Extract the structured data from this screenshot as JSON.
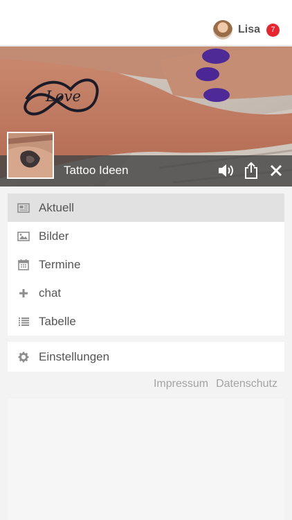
{
  "user": {
    "name": "Lisa",
    "notification_count": "7",
    "avatar_icon": "user-avatar"
  },
  "hero": {
    "title": "Tattoo Ideen",
    "tattoo_text": "Love",
    "bar_color": "#474747",
    "icons": [
      "volume-icon",
      "share-icon",
      "close-icon"
    ]
  },
  "menu": {
    "items": [
      {
        "label": "Aktuell",
        "icon": "newspaper-icon",
        "active": true
      },
      {
        "label": "Bilder",
        "icon": "image-icon",
        "active": false
      },
      {
        "label": "Termine",
        "icon": "calendar-icon",
        "active": false
      },
      {
        "label": "chat",
        "icon": "plus-icon",
        "active": false
      },
      {
        "label": "Tabelle",
        "icon": "list-icon",
        "active": false
      }
    ]
  },
  "settings": {
    "label": "Einstellungen",
    "icon": "gear-icon"
  },
  "footer": {
    "impressum": "Impressum",
    "datenschutz": "Datenschutz"
  },
  "colors": {
    "badge": "#e8252f",
    "active_item": "#e1e1e1",
    "text": "#555555",
    "link": "#a3a3a3"
  }
}
